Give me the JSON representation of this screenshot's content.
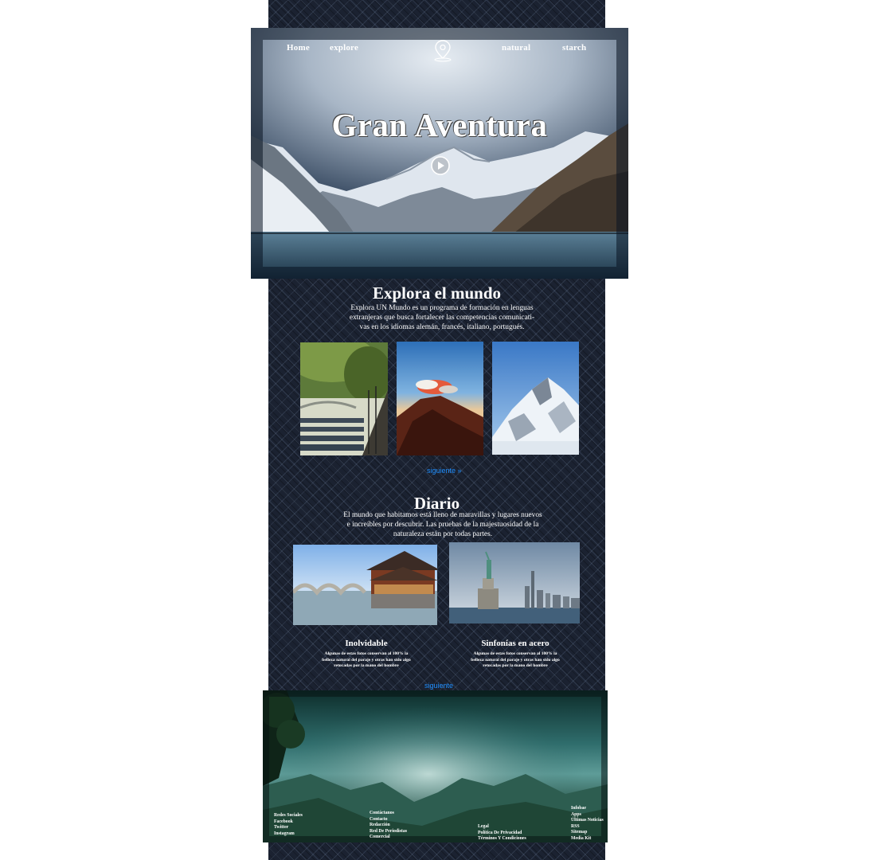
{
  "nav": {
    "items": [
      "Home",
      "explore",
      "natural",
      "starch"
    ]
  },
  "hero": {
    "title": "Gran Aventura",
    "logo_icon": "map-pin-icon",
    "play_icon": "play-icon"
  },
  "explore": {
    "title": "Explora el mundo",
    "text_lines": [
      "Explora UN Mundo es un programa de formación en lenguas",
      "extranjeras que busca fortalecer las competencias comunicati-",
      "vas en los idiomas alemán, francés, italiano, portugués."
    ],
    "gallery": [
      "river-bridge-photo",
      "volcano-photo",
      "snow-mountain-photo"
    ],
    "next_link": "siguiente »"
  },
  "diario": {
    "title": "Diario",
    "text_lines": [
      "El mundo que habitamos está lleno de maravillas y lugares nuevos",
      "e increíbles por descubrir. Las pruebas de la majestuosidad de la",
      "naturaleza están por todas partes."
    ],
    "cards": [
      {
        "title": "Inolvidable",
        "text_lines": [
          "Algunas de estas fotos conservan al 100% la",
          "belleza natural del paraje y otras han sido algo",
          "retocadas por la mano del hombre"
        ]
      },
      {
        "title": "Sinfonías en acero",
        "text_lines": [
          "Algunas de estas fotos conservan al 100% la",
          "belleza natural del paraje y otras han sido algo",
          "retocadas por la mano del hombre"
        ]
      }
    ],
    "next_link": "siguiente"
  },
  "footer": {
    "col1": [
      "Redes Sociales",
      "Facebook",
      "Twitter",
      "Instagram"
    ],
    "col2": [
      "Contáctanos",
      "Contacto",
      "Redacción",
      "Red De Periodistas",
      "Comercial"
    ],
    "col3": [
      "Legal",
      "Política De Privacidad",
      "Términos Y Condiciones"
    ],
    "col4": [
      "Infobae",
      "Apps",
      "Últimas Noticias",
      "RSS",
      "Sitemap",
      "Media Kit"
    ]
  },
  "colors": {
    "link_blue": "#1f8fff",
    "column_bg": "#1b2231"
  }
}
